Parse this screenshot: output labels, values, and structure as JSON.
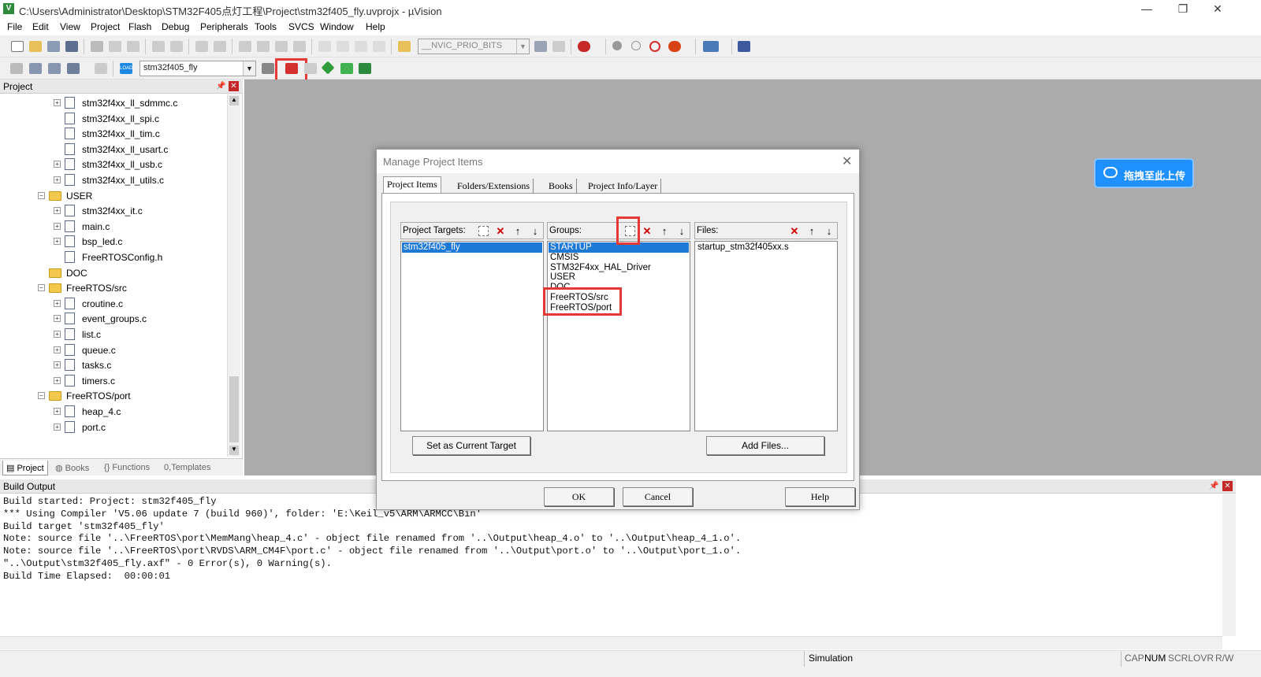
{
  "window": {
    "title": "C:\\Users\\Administrator\\Desktop\\STM32F405点灯工程\\Project\\stm32f405_fly.uvprojx - µVision",
    "app_icon": "V",
    "controls": [
      "—",
      "❐",
      "✕"
    ]
  },
  "menu": [
    "File",
    "Edit",
    "View",
    "Project",
    "Flash",
    "Debug",
    "Peripherals",
    "Tools",
    "SVCS",
    "Window",
    "Help"
  ],
  "toolbar": {
    "define_combo": "__NVIC_PRIO_BITS",
    "target_combo": "stm32f405_fly",
    "load_label": "LOAD"
  },
  "project_panel": {
    "title": "Project",
    "tree": [
      {
        "label": "stm32f4xx_ll_sdmmc.c",
        "kind": "file",
        "level": 2,
        "expandable": true
      },
      {
        "label": "stm32f4xx_ll_spi.c",
        "kind": "file",
        "level": 2,
        "expandable": false
      },
      {
        "label": "stm32f4xx_ll_tim.c",
        "kind": "file",
        "level": 2,
        "expandable": false
      },
      {
        "label": "stm32f4xx_ll_usart.c",
        "kind": "file",
        "level": 2,
        "expandable": false
      },
      {
        "label": "stm32f4xx_ll_usb.c",
        "kind": "file",
        "level": 2,
        "expandable": true
      },
      {
        "label": "stm32f4xx_ll_utils.c",
        "kind": "file",
        "level": 2,
        "expandable": true
      },
      {
        "label": "USER",
        "kind": "folder",
        "level": 1,
        "expandable": true
      },
      {
        "label": "stm32f4xx_it.c",
        "kind": "file",
        "level": 2,
        "expandable": true
      },
      {
        "label": "main.c",
        "kind": "file",
        "level": 2,
        "expandable": true
      },
      {
        "label": "bsp_led.c",
        "kind": "file",
        "level": 2,
        "expandable": true
      },
      {
        "label": "FreeRTOSConfig.h",
        "kind": "file",
        "level": 2,
        "expandable": false
      },
      {
        "label": "DOC",
        "kind": "folder",
        "level": 1,
        "expandable": false
      },
      {
        "label": "FreeRTOS/src",
        "kind": "folder",
        "level": 1,
        "expandable": true
      },
      {
        "label": "croutine.c",
        "kind": "file",
        "level": 2,
        "expandable": true
      },
      {
        "label": "event_groups.c",
        "kind": "file",
        "level": 2,
        "expandable": true
      },
      {
        "label": "list.c",
        "kind": "file",
        "level": 2,
        "expandable": true
      },
      {
        "label": "queue.c",
        "kind": "file",
        "level": 2,
        "expandable": true
      },
      {
        "label": "tasks.c",
        "kind": "file",
        "level": 2,
        "expandable": true
      },
      {
        "label": "timers.c",
        "kind": "file",
        "level": 2,
        "expandable": true
      },
      {
        "label": "FreeRTOS/port",
        "kind": "folder",
        "level": 1,
        "expandable": true
      },
      {
        "label": "heap_4.c",
        "kind": "file",
        "level": 2,
        "expandable": true
      },
      {
        "label": "port.c",
        "kind": "file",
        "level": 2,
        "expandable": true
      }
    ],
    "tabs": [
      {
        "label": "Project",
        "icon": "project-icon"
      },
      {
        "label": "Books",
        "icon": "books-icon"
      },
      {
        "label": "Functions",
        "icon": "functions-icon",
        "prefix": "{}"
      },
      {
        "label": "Templates",
        "icon": "templates-icon",
        "prefix": "0,"
      }
    ]
  },
  "cloud_upload": {
    "label": "拖拽至此上传"
  },
  "dialog": {
    "title": "Manage Project Items",
    "tabs": [
      "Project Items",
      "Folders/Extensions",
      "Books",
      "Project Info/Layer"
    ],
    "targets_label": "Project Targets:",
    "groups_label": "Groups:",
    "files_label": "Files:",
    "targets": [
      "stm32f405_fly"
    ],
    "groups": [
      "STARTUP",
      "CMSIS",
      "STM32F4xx_HAL_Driver",
      "USER",
      "DOC",
      "FreeRTOS/src",
      "FreeRTOS/port"
    ],
    "files": [
      "startup_stm32f405xx.s"
    ],
    "set_current_label": "Set as Current Target",
    "add_files_label": "Add Files...",
    "ok_label": "OK",
    "cancel_label": "Cancel",
    "help_label": "Help"
  },
  "build_output": {
    "title": "Build Output",
    "lines": [
      "Build started: Project: stm32f405_fly",
      "*** Using Compiler 'V5.06 update 7 (build 960)', folder: 'E:\\Keil_v5\\ARM\\ARMCC\\Bin'",
      "Build target 'stm32f405_fly'",
      "Note: source file '..\\FreeRTOS\\port\\MemMang\\heap_4.c' - object file renamed from '..\\Output\\heap_4.o' to '..\\Output\\heap_4_1.o'.",
      "Note: source file '..\\FreeRTOS\\port\\RVDS\\ARM_CM4F\\port.c' - object file renamed from '..\\Output\\port.o' to '..\\Output\\port_1.o'.",
      "\"..\\Output\\stm32f405_fly.axf\" - 0 Error(s), 0 Warning(s).",
      "Build Time Elapsed:  00:00:01"
    ]
  },
  "status": {
    "mode": "Simulation",
    "indicators": [
      "CAP",
      "NUM",
      "SCRL",
      "OVR",
      "R/W"
    ]
  }
}
